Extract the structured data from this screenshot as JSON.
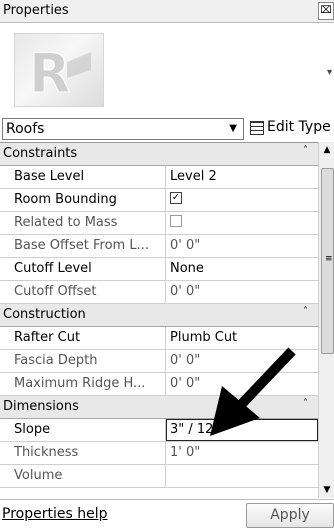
{
  "window": {
    "title": "Properties",
    "close_glyph": "⌧"
  },
  "preview": {
    "icon": "revit-family-thumbnail",
    "dropdown_glyph": "▾"
  },
  "type_selector": {
    "value": "Roofs",
    "arrow": "▼",
    "edit_type_label": "Edit Type"
  },
  "groups": [
    {
      "title": "Constraints",
      "collapse_glyph": "˄",
      "rows": [
        {
          "name": "Base Level",
          "value": "Level 2",
          "editable": true
        },
        {
          "name": "Room Bounding",
          "value": "✓",
          "type": "checkbox",
          "checked": true,
          "editable": true
        },
        {
          "name": "Related to Mass",
          "value": "",
          "type": "checkbox",
          "checked": false,
          "editable": false
        },
        {
          "name": "Base Offset From L...",
          "value": "0'  0\"",
          "editable": false
        },
        {
          "name": "Cutoff Level",
          "value": "None",
          "editable": true
        },
        {
          "name": "Cutoff Offset",
          "value": "0'  0\"",
          "editable": false
        }
      ]
    },
    {
      "title": "Construction",
      "collapse_glyph": "˄",
      "rows": [
        {
          "name": "Rafter Cut",
          "value": "Plumb Cut",
          "editable": true
        },
        {
          "name": "Fascia Depth",
          "value": "0'  0\"",
          "editable": false
        },
        {
          "name": "Maximum Ridge H...",
          "value": "0'  0\"",
          "editable": false
        }
      ]
    },
    {
      "title": "Dimensions",
      "collapse_glyph": "˄",
      "rows": [
        {
          "name": "Slope",
          "value": "3\" / 12\"",
          "editable": true,
          "editing": true
        },
        {
          "name": "Thickness",
          "value": "1'  0\"",
          "editable": false
        },
        {
          "name": "Volume",
          "value": "",
          "editable": false
        }
      ]
    }
  ],
  "scrollbar": {
    "up": "▲",
    "down": "▼",
    "grip": "≡"
  },
  "footer": {
    "help_link": "Properties help",
    "apply_button": "Apply"
  },
  "annotation": {
    "type": "arrow",
    "color": "#000000",
    "points_to": "Slope value field"
  }
}
